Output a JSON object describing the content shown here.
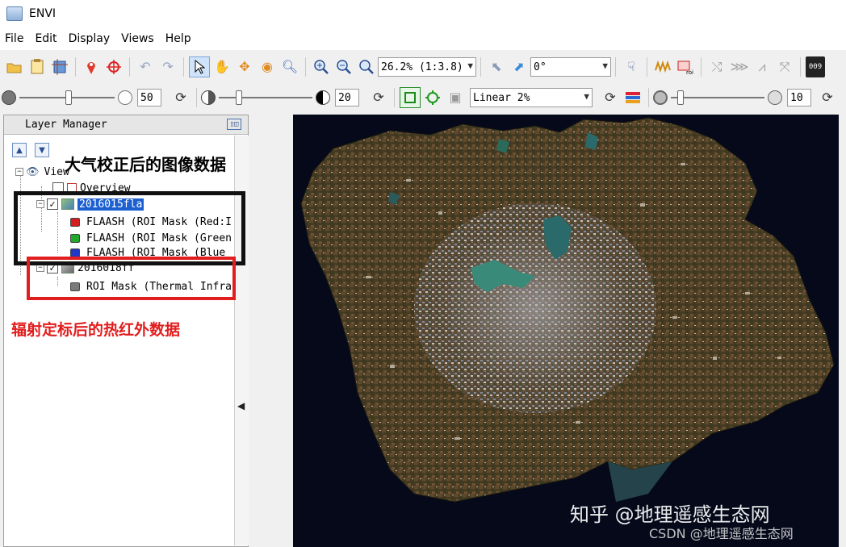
{
  "window": {
    "title": "ENVI"
  },
  "menu": [
    "File",
    "Edit",
    "Display",
    "Views",
    "Help"
  ],
  "toolbar1": {
    "zoom_value": "26.2% (1:3.8)",
    "rotation_value": "0°",
    "right_button_label": "009"
  },
  "toolbar2": {
    "brightness_value": "50",
    "contrast_value": "20",
    "stretch_value": "Linear 2%",
    "sharpen_value": "10"
  },
  "layer_manager": {
    "title": "Layer Manager",
    "view_label": "View",
    "overview_label": "Overview",
    "layer1": {
      "name": "2016015fla",
      "bands": [
        {
          "label": "FLAASH (ROI Mask (Red:I",
          "color": "#d21e1e"
        },
        {
          "label": "FLAASH (ROI Mask (Green",
          "color": "#1fa82c"
        },
        {
          "label": "FLAASH (ROI Mask (Blue",
          "color": "#2038c8"
        }
      ]
    },
    "layer2": {
      "name": "2016018ff",
      "bands": [
        {
          "label": "ROI Mask (Thermal Infra",
          "color": "#7a7a7a"
        }
      ]
    }
  },
  "annotations": {
    "black_label": "大气校正后的图像数据",
    "red_label": "辐射定标后的热红外数据"
  },
  "watermark": {
    "main": "知乎 @地理遥感生态网",
    "sub": "CSDN @地理遥感生态网"
  },
  "colors": {
    "selection": "#1c5fd0",
    "annotation_red": "#e21d1d",
    "annotation_black": "#111111",
    "view_background": "#05091a"
  }
}
